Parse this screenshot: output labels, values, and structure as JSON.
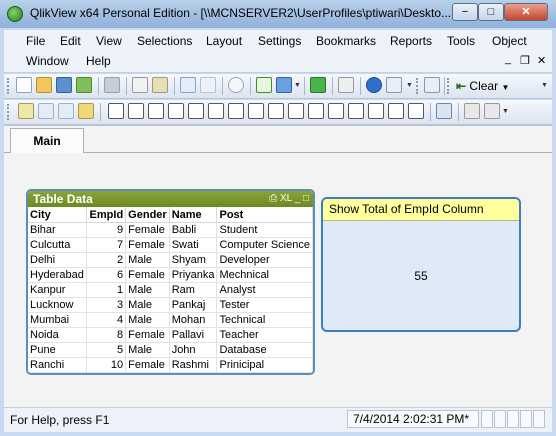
{
  "window": {
    "title": "QlikView x64 Personal Edition - [\\\\MCNSERVER2\\UserProfiles\\ptiwari\\Deskto...",
    "minimize": "−",
    "maximize": "□",
    "close": "✕"
  },
  "menu": {
    "items": [
      "File",
      "Edit",
      "View",
      "Selections",
      "Layout",
      "Settings",
      "Bookmarks",
      "Reports",
      "Tools",
      "Object",
      "Window",
      "Help"
    ],
    "mdi": [
      "_",
      "❐",
      "✕"
    ]
  },
  "toolbar": {
    "clear_label": "Clear"
  },
  "tabs": [
    {
      "label": "Main"
    }
  ],
  "table_box": {
    "caption": "Table Data",
    "caption_icons": "⎙ XL _ □",
    "columns": [
      "City",
      "EmpId",
      "Gender",
      "Name",
      "Post"
    ],
    "rows": [
      [
        "Bihar",
        "9",
        "Female",
        "Babli",
        "Student"
      ],
      [
        "Culcutta",
        "7",
        "Female",
        "Swati",
        "Computer Science"
      ],
      [
        "Delhi",
        "2",
        "Male",
        "Shyam",
        "Developer"
      ],
      [
        "Hyderabad",
        "6",
        "Female",
        "Priyanka",
        "Mechnical"
      ],
      [
        "Kanpur",
        "1",
        "Male",
        "Ram",
        "Analyst"
      ],
      [
        "Lucknow",
        "3",
        "Male",
        "Pankaj",
        "Tester"
      ],
      [
        "Mumbai",
        "4",
        "Male",
        "Mohan",
        "Technical"
      ],
      [
        "Noida",
        "8",
        "Female",
        "Pallavi",
        "Teacher"
      ],
      [
        "Pune",
        "5",
        "Male",
        "John",
        "Database"
      ],
      [
        "Ranchi",
        "10",
        "Female",
        "Rashmi",
        "Prinicipal"
      ]
    ]
  },
  "text_box": {
    "caption": "Show Total of EmpId Column",
    "value": "55"
  },
  "status": {
    "help": "For Help, press F1",
    "datetime": "7/4/2014 2:02:31 PM*"
  },
  "colors": {
    "table_caption": "#7a9a2a",
    "textbox_border": "#3a7fc0",
    "textbox_caption": "#ffff9e",
    "textbox_bg": "#dfe9f7"
  }
}
